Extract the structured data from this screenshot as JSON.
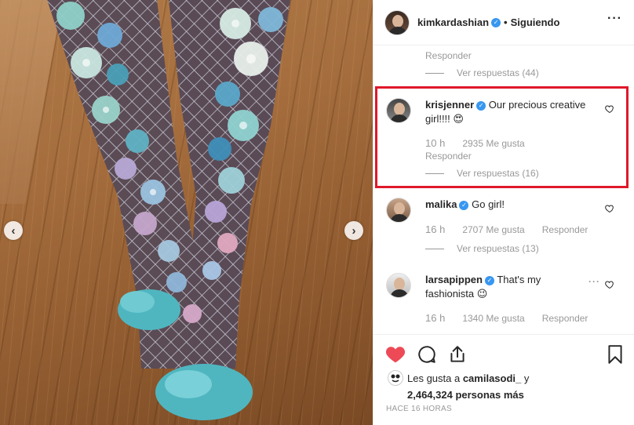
{
  "header": {
    "username": "kimkardashian",
    "separator": "•",
    "follow_state": "Siguiendo",
    "more": "···"
  },
  "top_thread": {
    "reply_label": "Responder",
    "view_replies": "Ver respuestas (44)"
  },
  "comments": [
    {
      "username": "krisjenner",
      "text": "Our precious creative girl!!!! 😍",
      "time": "10 h",
      "likes": "2935 Me gusta",
      "reply_label": "Responder",
      "view_replies": "Ver respuestas (16)",
      "highlighted": true
    },
    {
      "username": "malika",
      "text": "Go girl!",
      "time": "16 h",
      "likes": "2707 Me gusta",
      "reply_label": "Responder",
      "view_replies": "Ver respuestas (13)"
    },
    {
      "username": "larsapippen",
      "text": "That's my fashionista 😉",
      "time": "16 h",
      "likes": "1340 Me gusta",
      "reply_label": "Responder"
    }
  ],
  "actions": {
    "like_icon": "heart-filled-icon",
    "comment_icon": "comment-icon",
    "share_icon": "share-icon",
    "save_icon": "bookmark-icon"
  },
  "likes": {
    "prefix": "Les gusta a ",
    "user": "camilasodi_",
    "connector": " y",
    "count": "2,464,324 personas más"
  },
  "time_ago": "HACE 16 HORAS",
  "colors": {
    "verified": "#3897f0",
    "like_red": "#ed4956",
    "highlight": "#e0182a",
    "muted": "#999999"
  },
  "photo": {
    "prev_arrow": "‹",
    "next_arrow": "›"
  }
}
